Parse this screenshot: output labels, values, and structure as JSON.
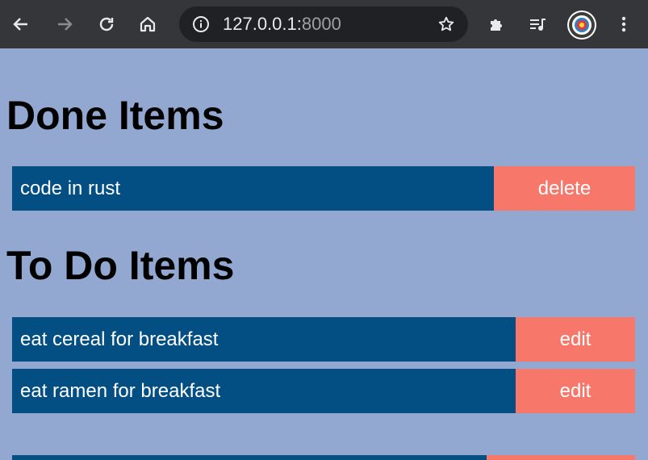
{
  "browser": {
    "url_host": "127.0.0.1:",
    "url_port": "8000",
    "icons": {
      "back": "back-arrow-icon",
      "forward": "forward-arrow-icon",
      "reload": "reload-icon",
      "home": "home-icon",
      "info": "info-icon",
      "star": "star-icon",
      "extensions": "puzzle-icon",
      "media": "media-queue-icon",
      "profile": "target-avatar-icon",
      "menu": "kebab-menu-icon"
    }
  },
  "page": {
    "done_heading": "Done Items",
    "todo_heading": "To Do Items",
    "done_items": [
      {
        "title": "code in rust",
        "action": "delete"
      }
    ],
    "todo_items": [
      {
        "title": "eat cereal for breakfast",
        "action": "edit"
      },
      {
        "title": "eat ramen for breakfast",
        "action": "edit"
      }
    ]
  },
  "colors": {
    "page_background": "#92a8d1",
    "item_background": "#034f84",
    "button_background": "#f7786b"
  }
}
